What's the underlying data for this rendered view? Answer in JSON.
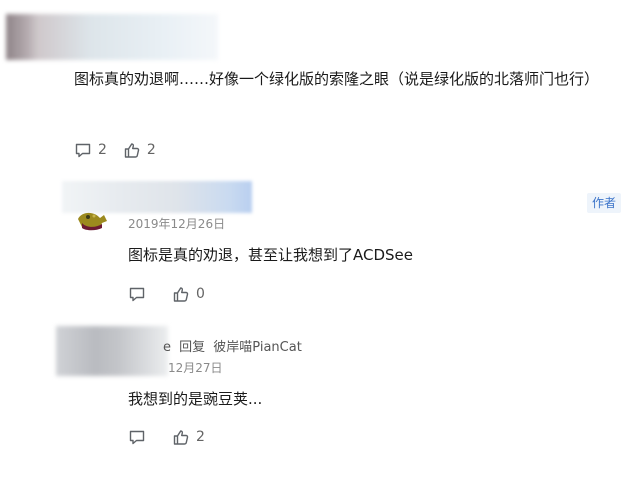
{
  "comment": {
    "text": "图标真的劝退啊……好像一个绿化版的索隆之眼（说是绿化版的北落师门也行）",
    "reply_count": "2",
    "like_count": "2"
  },
  "reply1": {
    "date": "2019年12月26日",
    "badge": "作者",
    "text": "图标是真的劝退，甚至让我想到了ACDSee",
    "like_count": "0"
  },
  "reply2": {
    "username_tail": "e",
    "reply_label": "回复",
    "reply_to": "彼岸喵PianCat",
    "date_partial": "12月27日",
    "text": "我想到的是豌豆荚...",
    "like_count": "2"
  },
  "icons": {
    "comment": "comment-icon",
    "like": "thumbs-up-icon"
  }
}
